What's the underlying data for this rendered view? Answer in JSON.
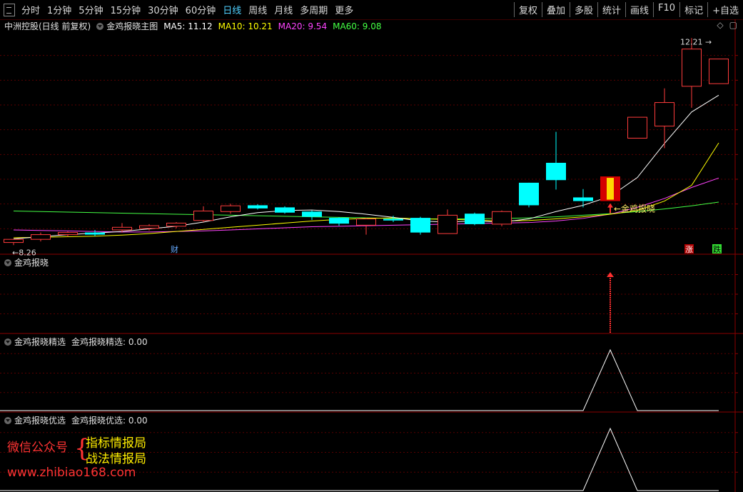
{
  "toolbar": {
    "periods": [
      "分时",
      "1分钟",
      "5分钟",
      "15分钟",
      "30分钟",
      "60分钟",
      "日线",
      "周线",
      "月线",
      "多周期",
      "更多"
    ],
    "active_period": "日线",
    "right_buttons": [
      "复权",
      "叠加",
      "多股",
      "统计",
      "画线",
      "F10",
      "标记",
      "+自选"
    ]
  },
  "main_panel": {
    "stock": "中洲控股(日线 前复权)",
    "indicator": "金鸡报晓主图",
    "ma": [
      {
        "label": "MA5: 11.12",
        "color": "#ffffff"
      },
      {
        "label": "MA10: 10.21",
        "color": "#ffff00"
      },
      {
        "label": "MA20: 9.54",
        "color": "#ff44ff"
      },
      {
        "label": "MA60: 9.08",
        "color": "#44ff44"
      }
    ],
    "low_label": "8.26",
    "high_label": "12.21",
    "signal_label": "金鸡报晓",
    "fin_marker": "财",
    "zhang_marker": "涨",
    "die_marker": "跌"
  },
  "panels": [
    {
      "title": "金鸡报晓",
      "value_text": ""
    },
    {
      "title": "金鸡报晓精选",
      "value_text": "金鸡报晓精选: 0.00"
    },
    {
      "title": "金鸡报晓优选",
      "value_text": "金鸡报晓优选: 0.00"
    }
  ],
  "watermark": {
    "wechat": "微信公众号",
    "line1": "指标情报局",
    "line2": "战法情报局",
    "url": "www.zhibiao168.com"
  },
  "chart_data": {
    "type": "candlestick",
    "ylim": [
      8.1,
      12.35
    ],
    "candles": [
      {
        "o": 8.31,
        "h": 8.37,
        "l": 8.26,
        "c": 8.37
      },
      {
        "o": 8.37,
        "h": 8.5,
        "l": 8.33,
        "c": 8.46
      },
      {
        "o": 8.46,
        "h": 8.52,
        "l": 8.42,
        "c": 8.5
      },
      {
        "o": 8.5,
        "h": 8.55,
        "l": 8.43,
        "c": 8.46
      },
      {
        "o": 8.55,
        "h": 8.68,
        "l": 8.5,
        "c": 8.6
      },
      {
        "o": 8.58,
        "h": 8.66,
        "l": 8.54,
        "c": 8.63
      },
      {
        "o": 8.62,
        "h": 8.7,
        "l": 8.58,
        "c": 8.68
      },
      {
        "o": 8.73,
        "h": 9.0,
        "l": 8.7,
        "c": 8.91
      },
      {
        "o": 8.9,
        "h": 9.05,
        "l": 8.86,
        "c": 9.01
      },
      {
        "o": 9.02,
        "h": 9.04,
        "l": 8.94,
        "c": 8.96
      },
      {
        "o": 8.98,
        "h": 9.0,
        "l": 8.86,
        "c": 8.88
      },
      {
        "o": 8.9,
        "h": 8.92,
        "l": 8.74,
        "c": 8.8
      },
      {
        "o": 8.78,
        "h": 8.79,
        "l": 8.63,
        "c": 8.67
      },
      {
        "o": 8.64,
        "h": 8.78,
        "l": 8.46,
        "c": 8.76
      },
      {
        "o": 8.76,
        "h": 8.82,
        "l": 8.7,
        "c": 8.73
      },
      {
        "o": 8.78,
        "h": 8.8,
        "l": 8.46,
        "c": 8.5
      },
      {
        "o": 8.48,
        "h": 8.94,
        "l": 8.48,
        "c": 8.83
      },
      {
        "o": 8.86,
        "h": 8.88,
        "l": 8.64,
        "c": 8.66
      },
      {
        "o": 8.66,
        "h": 8.92,
        "l": 8.62,
        "c": 8.9
      },
      {
        "o": 9.45,
        "h": 9.45,
        "l": 8.98,
        "c": 9.02
      },
      {
        "o": 9.83,
        "h": 10.42,
        "l": 9.32,
        "c": 9.5
      },
      {
        "o": 9.17,
        "h": 9.33,
        "l": 8.98,
        "c": 9.1
      },
      {
        "o": 9.1,
        "h": 9.57,
        "l": 9.1,
        "c": 9.57,
        "signal": true
      },
      {
        "o": 10.3,
        "h": 10.7,
        "l": 10.3,
        "c": 10.7
      },
      {
        "o": 10.53,
        "h": 11.25,
        "l": 10.11,
        "c": 10.98
      },
      {
        "o": 11.29,
        "h": 12.21,
        "l": 10.88,
        "c": 12.0
      },
      {
        "o": 11.34,
        "h": 11.77,
        "l": 11.34,
        "c": 11.81
      }
    ],
    "ma5": [
      8.38,
      8.42,
      8.46,
      8.49,
      8.52,
      8.57,
      8.62,
      8.7,
      8.8,
      8.88,
      8.92,
      8.93,
      8.9,
      8.85,
      8.79,
      8.72,
      8.7,
      8.72,
      8.7,
      8.76,
      8.9,
      9.02,
      9.19,
      9.55,
      10.2,
      10.8,
      11.12
    ],
    "ma10": [
      8.4,
      8.41,
      8.42,
      8.43,
      8.45,
      8.48,
      8.52,
      8.56,
      8.6,
      8.64,
      8.68,
      8.72,
      8.75,
      8.77,
      8.78,
      8.76,
      8.75,
      8.74,
      8.72,
      8.73,
      8.76,
      8.8,
      8.85,
      8.92,
      9.1,
      9.4,
      10.21
    ],
    "ma20": [
      8.55,
      8.54,
      8.53,
      8.52,
      8.51,
      8.51,
      8.52,
      8.53,
      8.55,
      8.57,
      8.59,
      8.61,
      8.62,
      8.63,
      8.64,
      8.65,
      8.66,
      8.67,
      8.68,
      8.69,
      8.72,
      8.77,
      8.85,
      8.98,
      9.15,
      9.36,
      9.54
    ],
    "ma60": [
      8.91,
      8.9,
      8.89,
      8.88,
      8.87,
      8.86,
      8.85,
      8.84,
      8.83,
      8.82,
      8.81,
      8.8,
      8.79,
      8.78,
      8.77,
      8.76,
      8.76,
      8.76,
      8.77,
      8.78,
      8.8,
      8.83,
      8.86,
      8.9,
      8.95,
      9.01,
      9.08
    ],
    "signal_index": 22,
    "jingxuan": [
      0,
      0,
      0,
      0,
      0,
      0,
      0,
      0,
      0,
      0,
      0,
      0,
      0,
      0,
      0,
      0,
      0,
      0,
      0,
      0,
      0,
      0,
      1,
      0,
      0,
      0,
      0
    ],
    "youxuan": [
      0,
      0,
      0,
      0,
      0,
      0,
      0,
      0,
      0,
      0,
      0,
      0,
      0,
      0,
      0,
      0,
      0,
      0,
      0,
      0,
      0,
      0,
      1,
      0,
      0,
      0,
      0
    ]
  },
  "colors": {
    "up": "#ff3c3c",
    "down": "#00ffff",
    "axis": "#8b0000",
    "grid": "#5a0000",
    "signal_red": "#d40000",
    "signal_yellow": "#ffd800"
  }
}
